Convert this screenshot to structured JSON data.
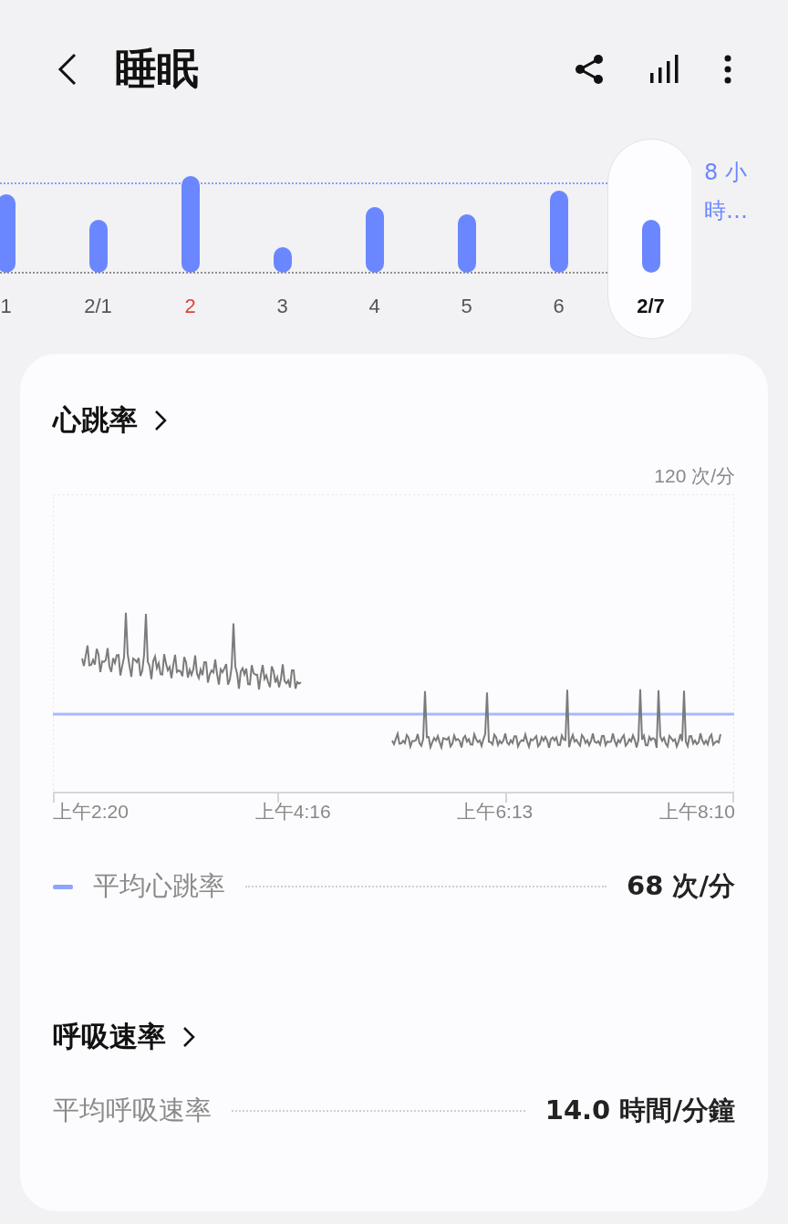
{
  "header": {
    "title": "睡眠"
  },
  "sleep_days": [
    {
      "label": "1",
      "selected": false,
      "color": "#555555"
    },
    {
      "label": "2/1",
      "selected": false,
      "color": "#555555"
    },
    {
      "label": "2",
      "selected": false,
      "color": "#e0413a"
    },
    {
      "label": "3",
      "selected": false,
      "color": "#555555"
    },
    {
      "label": "4",
      "selected": false,
      "color": "#555555"
    },
    {
      "label": "5",
      "selected": false,
      "color": "#555555"
    },
    {
      "label": "6",
      "selected": false,
      "color": "#555555"
    },
    {
      "label": "2/7",
      "selected": true,
      "color": "#111111"
    }
  ],
  "goal_label": "8 小時…",
  "heart_rate": {
    "title": "心跳率",
    "y_max_label": "120 次/分",
    "x_labels": [
      "上午2:20",
      "上午4:16",
      "上午6:13",
      "上午8:10"
    ],
    "legend": {
      "label": "平均心跳率",
      "value": "68 次/分"
    }
  },
  "respiration": {
    "title": "呼吸速率",
    "label": "平均呼吸速率",
    "value": "14.0 時間/分鐘"
  }
}
